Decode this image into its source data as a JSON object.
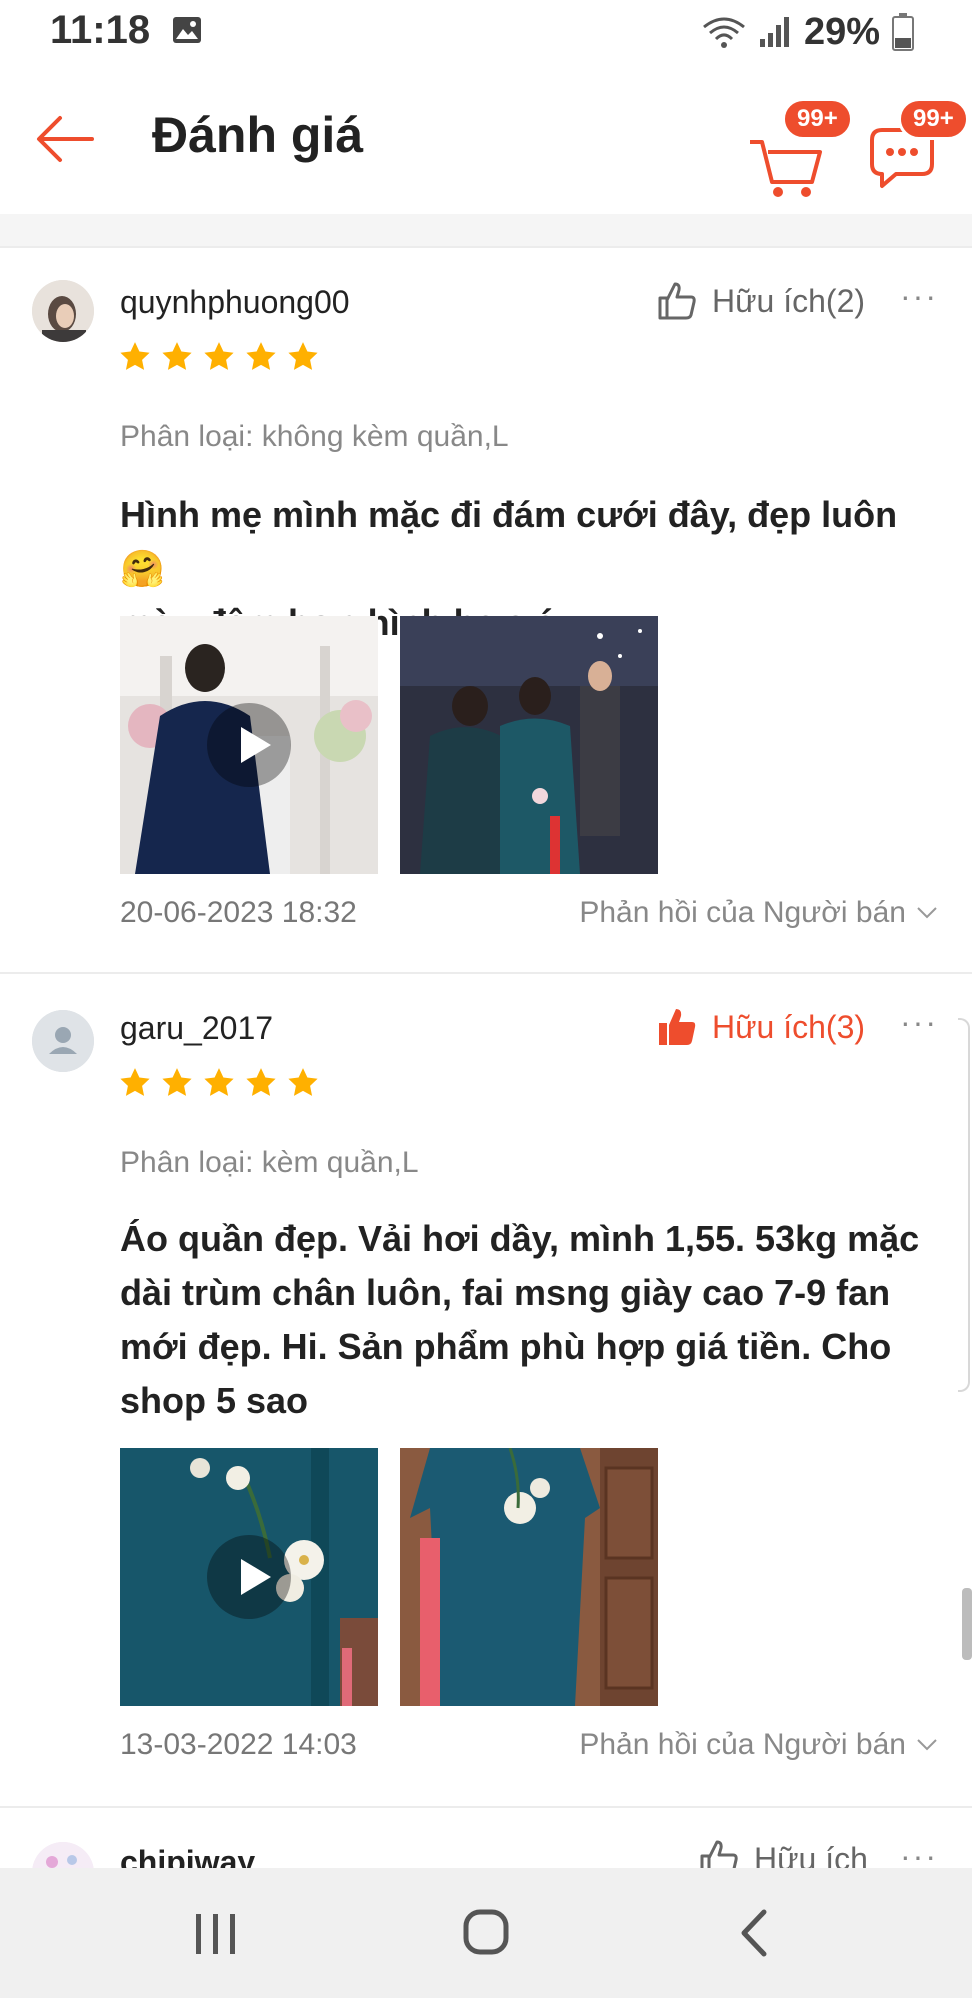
{
  "status_bar": {
    "time": "11:18",
    "battery": "29%",
    "icons": [
      "gallery-icon",
      "wifi-icon",
      "signal-icon",
      "battery-icon"
    ]
  },
  "header": {
    "title": "Đánh giá",
    "cart_badge": "99+",
    "chat_badge": "99+",
    "accent_color": "#ee4d2d"
  },
  "reviews": [
    {
      "username": "quynhphuong00",
      "helpful": "Hữu ích(2)",
      "helpful_active": false,
      "more": "···",
      "rating": 5,
      "variation": "Phân loại: không kèm quần,L",
      "comment_line1": "Hình mẹ mình mặc đi đám cưới đây, đẹp luôn🤗",
      "comment_line2": "màu đậm hơn hình ha s á",
      "date": "20-06-2023 18:32",
      "seller_reply": "Phản hồi của Người bán"
    },
    {
      "username": "garu_2017",
      "helpful": "Hữu ích(3)",
      "helpful_active": true,
      "more": "···",
      "rating": 5,
      "variation": "Phân loại: kèm quần,L",
      "comment_line1": "Áo quần đẹp. Vải hơi dầy, mình 1,55. 53kg mặc",
      "comment_line2": "dài trùm chân luôn, fai msng giày cao 7-9 fan",
      "comment_line3": "mới đẹp. Hi. Sản phẩm phù hợp giá tiền. Cho",
      "comment_line4": "shop 5 sao",
      "date": "13-03-2022 14:03",
      "seller_reply": "Phản hồi của Người bán"
    },
    {
      "username": "chipiway",
      "helpful": "Hữu ích",
      "more": "···"
    }
  ]
}
